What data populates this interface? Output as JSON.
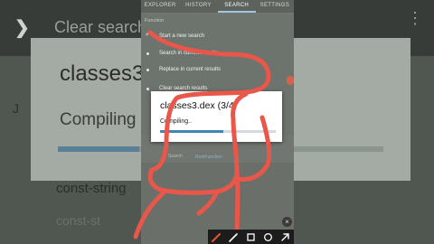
{
  "background": {
    "title": "Clear search",
    "card_title": "classes3",
    "card_status": "Compiling",
    "line1": "const-string",
    "line2": "const-st",
    "side_letter": "J"
  },
  "phone": {
    "tabs": [
      {
        "label": "EXPLORER",
        "active": false
      },
      {
        "label": "HISTORY",
        "active": false
      },
      {
        "label": "SEARCH",
        "active": true
      },
      {
        "label": "SETTINGS",
        "active": false
      }
    ],
    "menu_header": "Function",
    "menu_items": [
      "Start a new search",
      "Search in current results",
      "Replace in current results",
      "Clear search results"
    ],
    "footer_text": "Search",
    "footer_link": "RootFunction",
    "dialog": {
      "title": "classes3.dex (3/4)",
      "status": "Compiling..",
      "progress": 0.55
    }
  },
  "toolbar": {
    "tools": [
      {
        "name": "pen-tool-icon",
        "color": "#e4572e"
      },
      {
        "name": "eraser-tool-icon",
        "color": "#ffffff"
      },
      {
        "name": "rectangle-tool-icon",
        "color": "#ffffff"
      },
      {
        "name": "circle-tool-icon",
        "color": "#ffffff"
      },
      {
        "name": "arrow-tool-icon",
        "color": "#ffffff"
      }
    ],
    "close_glyph": "×"
  },
  "colors": {
    "annotation": "#e9564a",
    "accent": "#3f86b3"
  }
}
